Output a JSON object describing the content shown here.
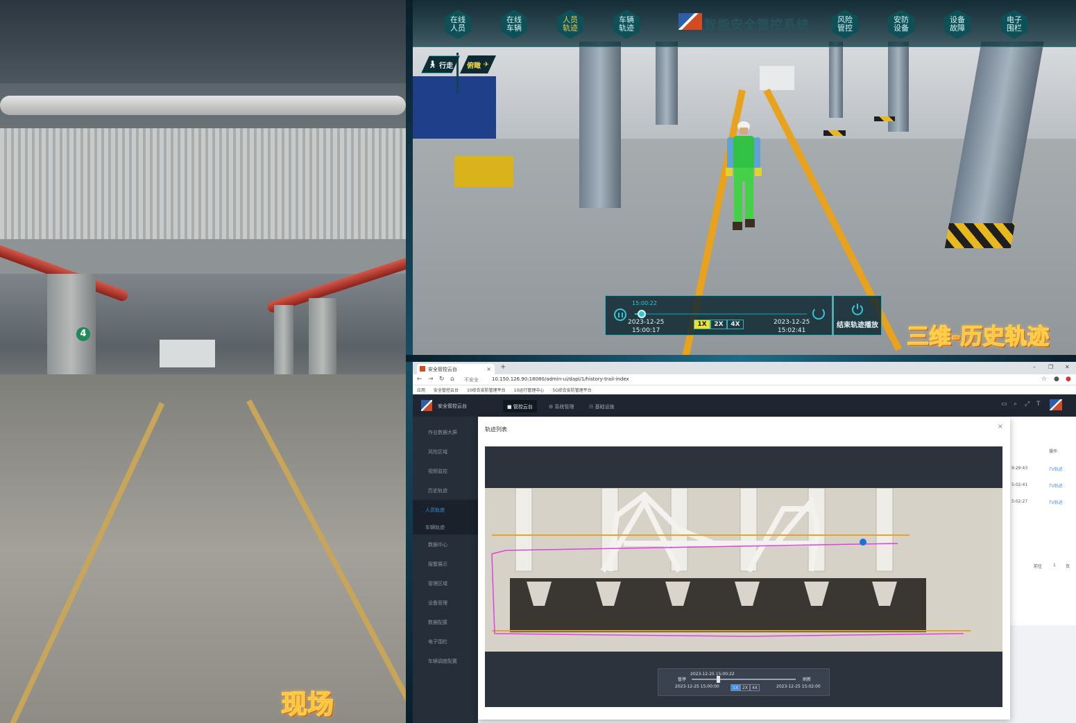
{
  "site_panel": {
    "label": "现场"
  },
  "viewer": {
    "nav_items": [
      {
        "label": "在线人员",
        "active": false
      },
      {
        "label": "在线车辆",
        "active": false
      },
      {
        "label": "人员轨迹",
        "active": true
      },
      {
        "label": "车辆轨迹",
        "active": false
      },
      {
        "label": "风险管控",
        "active": false
      },
      {
        "label": "安防设备",
        "active": false
      },
      {
        "label": "设备故障",
        "active": false
      },
      {
        "label": "电子围栏",
        "active": false
      }
    ],
    "system_title": "智能安全管控系统",
    "mode_walk": "行走",
    "mode_fly": "俯瞰",
    "playback": {
      "current_time": "15:00:22",
      "start_date": "2023-12-25",
      "start_time": "15:00:17",
      "end_date": "2023-12-25",
      "end_time": "15:02:41",
      "progress": 0.04,
      "speeds": [
        "1X",
        "2X",
        "4X"
      ],
      "active_speed": "1X",
      "end_label": "结束轨迹播放"
    },
    "overlay_label": "三维-历史轨迹"
  },
  "browser": {
    "tab_title": "安全管控云台",
    "tab_close": "×",
    "new_tab": "+",
    "security_warning": "不安全",
    "url": "10.150.126.90:18080/admin-ui/dapi/1/history-trail-index",
    "bookmarks": [
      "应用",
      "安全管控云台",
      "10综合安防管理平台",
      "10运行管理中心",
      "5G综合安防管理平台"
    ],
    "app": {
      "name": "安全管控云台",
      "top_nav": [
        {
          "label": "■ 管控云台",
          "active": true
        },
        {
          "label": "⚙ 系统管理",
          "active": false
        },
        {
          "label": "☷ 基础设施",
          "active": false
        }
      ],
      "sidebar": [
        {
          "label": "作业数据大屏",
          "sub": false,
          "active": false
        },
        {
          "label": "风险区域",
          "sub": false,
          "active": false
        },
        {
          "label": "视频监控",
          "sub": false,
          "active": false
        },
        {
          "label": "历史轨迹",
          "sub": false,
          "active": false
        },
        {
          "label": "人员轨迹",
          "sub": true,
          "active": true
        },
        {
          "label": "车辆轨迹",
          "sub": true,
          "active": false
        },
        {
          "label": "数据中心",
          "sub": false,
          "active": false
        },
        {
          "label": "报警展示",
          "sub": false,
          "active": false
        },
        {
          "label": "管理区域",
          "sub": false,
          "active": false
        },
        {
          "label": "设备管理",
          "sub": false,
          "active": false
        },
        {
          "label": "数据配置",
          "sub": false,
          "active": false
        },
        {
          "label": "电子围栏",
          "sub": false,
          "active": false
        },
        {
          "label": "车辆调度配置",
          "sub": false,
          "active": false
        }
      ],
      "modal": {
        "title": "轨迹列表",
        "close": "×",
        "controls": {
          "current": "2023-12-25 15:00:22",
          "pause_label": "暂停",
          "refresh_label": "刷新",
          "start": "2023-12-25 15:00:00",
          "end": "2023-12-25 15:02:00",
          "progress": 0.25,
          "speeds": [
            "1X",
            "2X",
            "4X"
          ],
          "active_speed": "1X"
        }
      },
      "background_table": {
        "header_op": "操作",
        "rows": [
          {
            "time": "9:29:43",
            "action": "TV轨迹"
          },
          {
            "time": "5:02:41",
            "action": "TV轨迹"
          },
          {
            "time": "5:02:27",
            "action": "TV轨迹"
          }
        ],
        "goto_label": "前往",
        "page": "1",
        "page_suffix": "页"
      }
    }
  },
  "colors": {
    "accent_cyan": "#36c8d2",
    "speed_active": "#f0e324",
    "label_orange": "#ff9b2c",
    "trail_magenta": "#e040e0",
    "app_blue": "#3d8ff0"
  }
}
